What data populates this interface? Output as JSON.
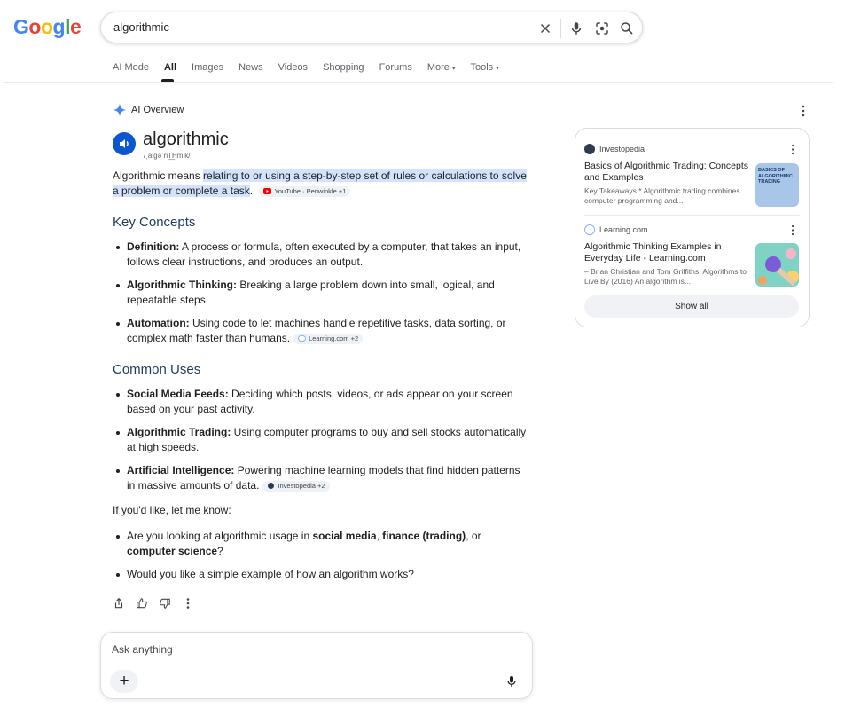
{
  "search": {
    "query": "algorithmic"
  },
  "tabs": [
    {
      "label": "AI Mode"
    },
    {
      "label": "All"
    },
    {
      "label": "Images"
    },
    {
      "label": "News"
    },
    {
      "label": "Videos"
    },
    {
      "label": "Shopping"
    },
    {
      "label": "Forums"
    },
    {
      "label": "More"
    },
    {
      "label": "Tools"
    }
  ],
  "overview": {
    "label": "AI Overview",
    "word": "algorithmic",
    "pronunciation": "/ˌalɡəˈriT͟Hmik/",
    "definition_prefix": "Algorithmic means ",
    "definition_highlight": "relating to or using a step-by-step set of rules or calculations to solve a problem or complete a task",
    "definition_suffix": ".",
    "definition_source": "YouTube · Periwinkle +1",
    "key_concepts_heading": "Key Concepts",
    "key_concepts": [
      {
        "term": "Definition:",
        "text": " A process or formula, often executed by a computer, that takes an input, follows clear instructions, and produces an output."
      },
      {
        "term": "Algorithmic Thinking:",
        "text": " Breaking a large problem down into small, logical, and repeatable steps."
      },
      {
        "term": "Automation:",
        "text": " Using code to let machines handle repetitive tasks, data sorting, or complex math faster than humans.",
        "source": "Learning.com +2"
      }
    ],
    "common_uses_heading": "Common Uses",
    "common_uses": [
      {
        "term": "Social Media Feeds:",
        "text": " Deciding which posts, videos, or ads appear on your screen based on your past activity."
      },
      {
        "term": "Algorithmic Trading:",
        "text": " Using computer programs to buy and sell stocks automatically at high speeds."
      },
      {
        "term": "Artificial Intelligence:",
        "text": " Powering machine learning models that find hidden patterns in massive amounts of data.",
        "source": "Investopedia +2"
      }
    ],
    "followup_intro": "If you'd like, let me know:",
    "followups": {
      "q1_a": "Are you looking at algorithmic usage in ",
      "q1_b": "social media",
      "q1_c": ", ",
      "q1_d": "finance (trading)",
      "q1_e": ", or ",
      "q1_f": "computer science",
      "q1_g": "?",
      "q2": "Would you like a simple example of how an algorithm works?"
    }
  },
  "ask": {
    "placeholder": "Ask anything",
    "plus": "+"
  },
  "sources": {
    "cards": [
      {
        "source": "Investopedia",
        "title": "Basics of Algorithmic Trading: Concepts and Examples",
        "snippet": "Key Takeaways * Algorithmic trading combines computer programming and...",
        "thumb_text": "BASICS OF ALGORITHMIC TRADING"
      },
      {
        "source": "Learning.com",
        "title": "Algorithmic Thinking Examples in Everyday Life - Learning.com",
        "snippet": "– Brian Christian and Tom Griffiths, Algorithms to Live By (2016) An algorithm is..."
      }
    ],
    "show_all": "Show all"
  },
  "colors": {
    "accent_blue": "#0b57d0",
    "highlight": "#d3e3fd",
    "heading": "#1e3a5f"
  }
}
